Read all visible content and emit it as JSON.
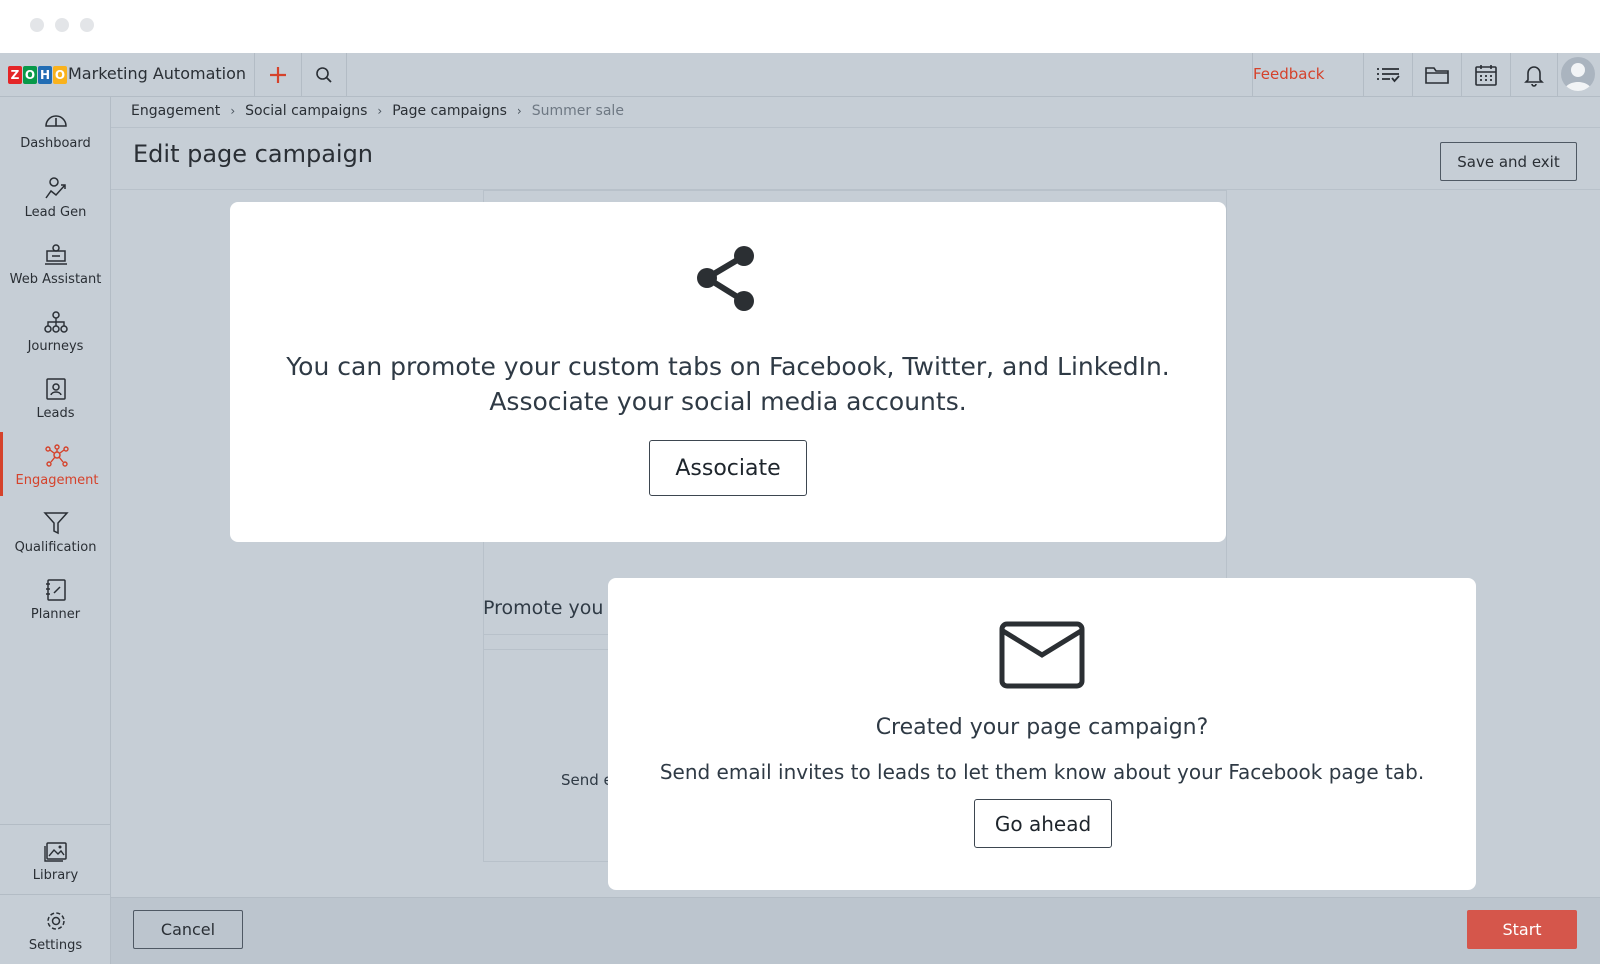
{
  "topbar": {
    "app_name": "Marketing Automation",
    "logo_letters": [
      "Z",
      "O",
      "H",
      "O"
    ],
    "logo_colors": [
      "#e42527",
      "#089949",
      "#226db4",
      "#f9b21d"
    ],
    "feedback_label": "Feedback",
    "icons": [
      "add-icon",
      "search-icon",
      "task-list-icon",
      "folder-icon",
      "calendar-icon",
      "bell-icon",
      "user-avatar-icon"
    ]
  },
  "breadcrumb": {
    "items": [
      "Engagement",
      "Social campaigns",
      "Page campaigns"
    ],
    "current": "Summer sale"
  },
  "header": {
    "title": "Edit page campaign",
    "save_exit_label": "Save and exit"
  },
  "sidebar": {
    "items": [
      {
        "label": "Dashboard",
        "icon": "dashboard-icon"
      },
      {
        "label": "Lead Gen",
        "icon": "lead-gen-icon"
      },
      {
        "label": "Web Assistant",
        "icon": "web-assistant-icon"
      },
      {
        "label": "Journeys",
        "icon": "journeys-icon"
      },
      {
        "label": "Leads",
        "icon": "leads-icon"
      },
      {
        "label": "Engagement",
        "icon": "engagement-icon",
        "active": true
      },
      {
        "label": "Qualification",
        "icon": "qualification-icon"
      },
      {
        "label": "Planner",
        "icon": "planner-icon"
      }
    ],
    "bottom_items": [
      {
        "label": "Library",
        "icon": "library-icon"
      },
      {
        "label": "Settings",
        "icon": "settings-icon"
      }
    ]
  },
  "background": {
    "promote_heading": "Promote you",
    "send_snippet": "Send e"
  },
  "social_card": {
    "icon": "share-icon",
    "line1": "You can promote your custom tabs on Facebook, Twitter, and LinkedIn.",
    "line2": "Associate your social media accounts.",
    "button_label": "Associate"
  },
  "email_card": {
    "icon": "envelope-icon",
    "heading": "Created your page campaign?",
    "description": "Send email invites to leads to let them know about your Facebook page tab.",
    "button_label": "Go ahead"
  },
  "footer": {
    "cancel_label": "Cancel",
    "start_label": "Start"
  },
  "colors": {
    "accent": "#d5422b",
    "start_button": "#d5564b",
    "chrome_background": "#c6ced6"
  }
}
